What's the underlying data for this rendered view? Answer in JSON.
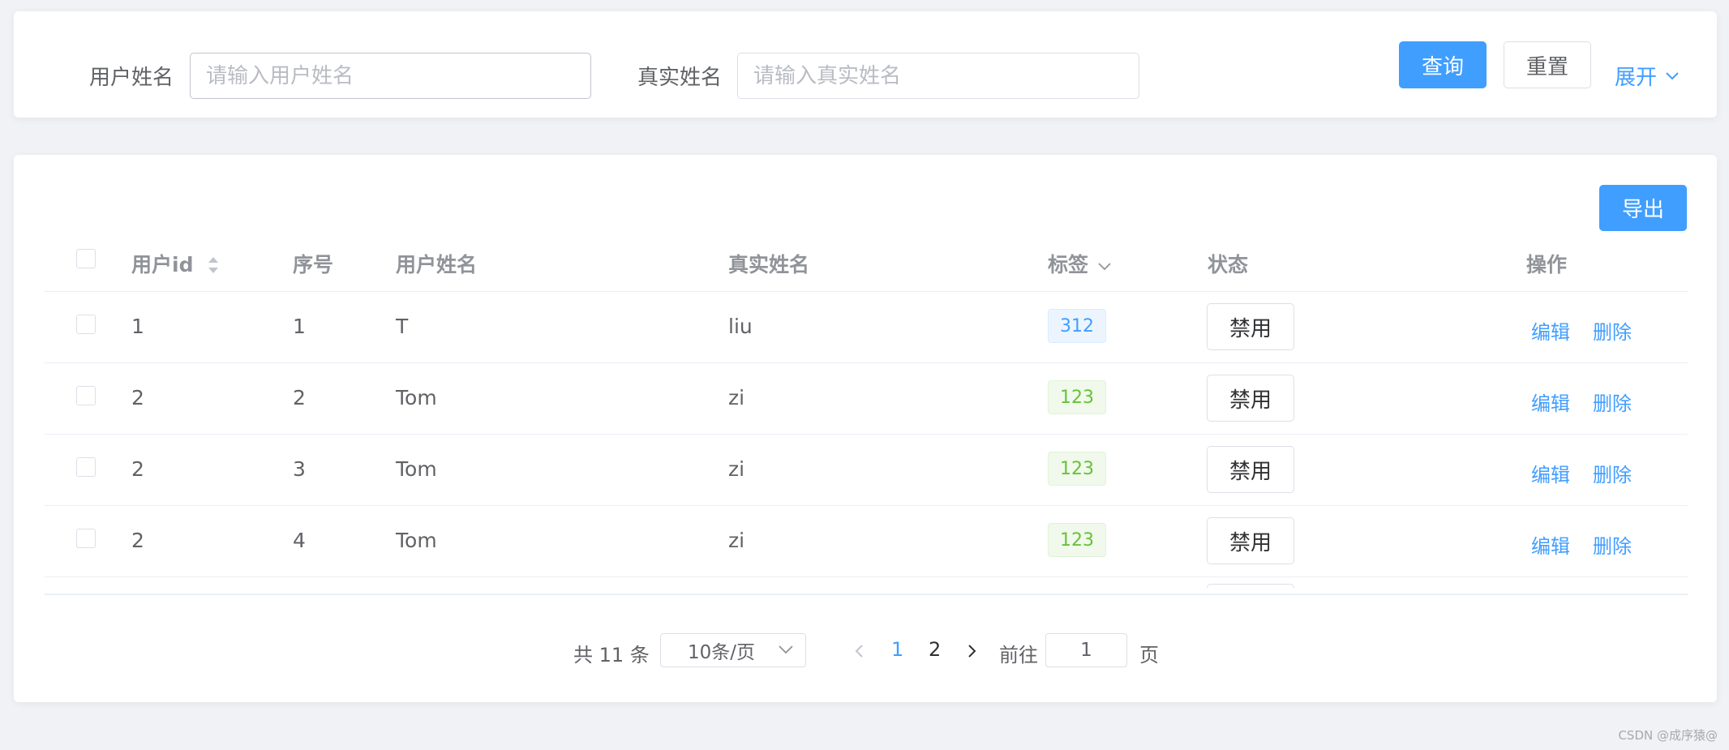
{
  "search": {
    "username_label": "用户姓名",
    "username_placeholder": "请输入用户姓名",
    "realname_label": "真实姓名",
    "realname_placeholder": "请输入真实姓名",
    "query_label": "查询",
    "reset_label": "重置",
    "expand_label": "展开"
  },
  "toolbar": {
    "export_label": "导出"
  },
  "table": {
    "headers": {
      "user_id": "用户id",
      "index": "序号",
      "username": "用户姓名",
      "realname": "真实姓名",
      "tag": "标签",
      "status": "状态",
      "actions": "操作"
    },
    "rows": [
      {
        "user_id": "1",
        "index": "1",
        "username": "T",
        "realname": "liu",
        "tag": "312",
        "tag_color": "#409eff",
        "status_button": "禁用",
        "edit": "编辑",
        "delete": "删除"
      },
      {
        "user_id": "2",
        "index": "2",
        "username": "Tom",
        "realname": "zi",
        "tag": "123",
        "tag_color": "#67c23a",
        "status_button": "禁用",
        "edit": "编辑",
        "delete": "删除"
      },
      {
        "user_id": "2",
        "index": "3",
        "username": "Tom",
        "realname": "zi",
        "tag": "123",
        "tag_color": "#67c23a",
        "status_button": "禁用",
        "edit": "编辑",
        "delete": "删除"
      },
      {
        "user_id": "2",
        "index": "4",
        "username": "Tom",
        "realname": "zi",
        "tag": "123",
        "tag_color": "#67c23a",
        "status_button": "禁用",
        "edit": "编辑",
        "delete": "删除"
      }
    ]
  },
  "pagination": {
    "total_text": "共 11 条",
    "page_size": "10条/页",
    "pages": [
      "1",
      "2"
    ],
    "current_page": "1",
    "goto_label": "前往",
    "goto_value": "1",
    "page_suffix": "页"
  },
  "watermark": "CSDN @成序猿@",
  "colors": {
    "primary": "#409eff",
    "success": "#67c23a",
    "background": "#f0f2f5"
  }
}
